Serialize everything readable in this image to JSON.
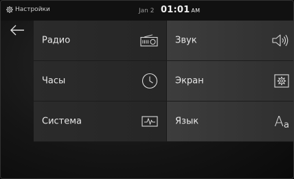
{
  "status_bar": {
    "title": "Настройки",
    "title_icon": "gear-icon",
    "date": "Jan 2",
    "time": "01:01",
    "ampm": "AM"
  },
  "back_icon": "arrow-left-icon",
  "menu": [
    {
      "label": "Радио",
      "icon": "radio-icon"
    },
    {
      "label": "Звук",
      "icon": "speaker-icon"
    },
    {
      "label": "Часы",
      "icon": "clock-icon"
    },
    {
      "label": "Экран",
      "icon": "display-settings-icon"
    },
    {
      "label": "Система",
      "icon": "system-pulse-icon"
    },
    {
      "label": "Язык",
      "icon": "language-icon"
    }
  ],
  "language_icon_glyph": {
    "big": "A",
    "small": "a"
  }
}
